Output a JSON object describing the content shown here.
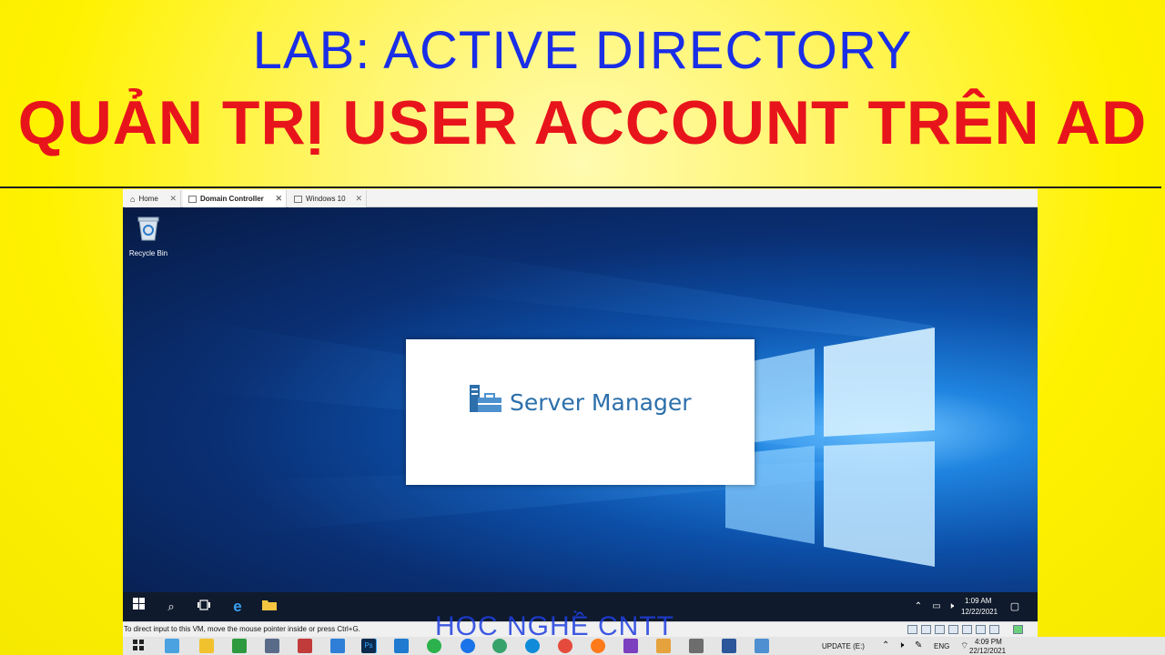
{
  "banner": {
    "line1": "LAB: ACTIVE DIRECTORY",
    "line2": "QUẢN TRỊ USER ACCOUNT TRÊN AD"
  },
  "vm_tabs": [
    {
      "label": "Home",
      "icon": "home-icon",
      "active": false
    },
    {
      "label": "Domain Controller",
      "icon": "vm-icon",
      "active": true
    },
    {
      "label": "Windows 10",
      "icon": "vm-icon",
      "active": false
    }
  ],
  "desktop": {
    "recycle_bin_label": "Recycle Bin",
    "splash_title": "Server Manager"
  },
  "guest_taskbar": {
    "time": "1:09 AM",
    "date": "12/22/2021"
  },
  "vm_status": {
    "hint": "To direct input to this VM, move the mouse pointer inside or press Ctrl+G."
  },
  "watermark": "HỌC NGHỀ CNTT",
  "host_taskbar": {
    "drive_label": "UPDATE (E:)",
    "language": "ENG",
    "time": "4:09 PM",
    "date": "22/12/2021"
  },
  "colors": {
    "banner_blue": "#1a2ee6",
    "banner_red": "#e8141c",
    "banner_yellow": "#fff200",
    "server_manager_blue": "#2c6fab"
  }
}
